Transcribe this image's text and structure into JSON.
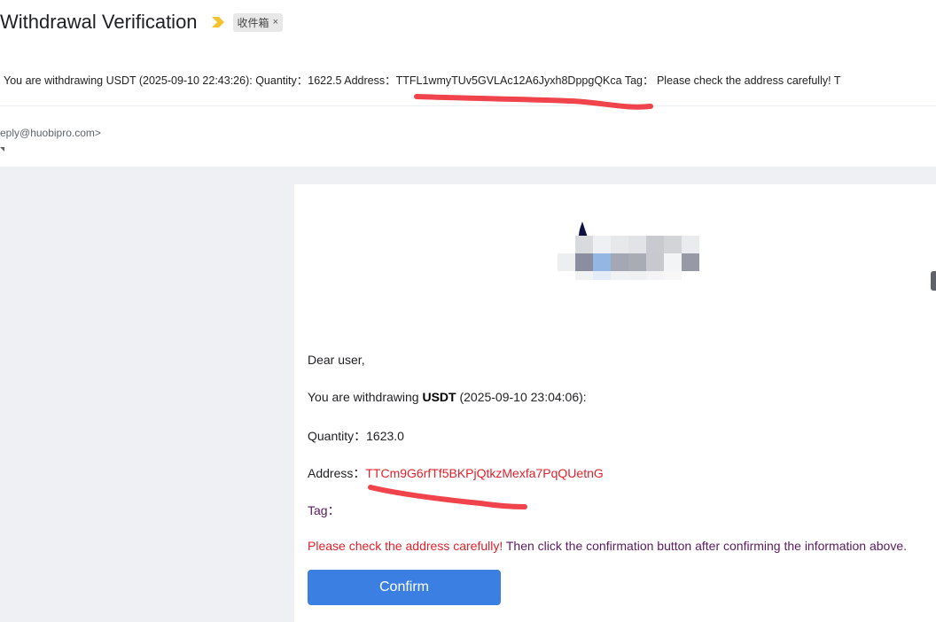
{
  "header": {
    "subject": "Withdrawal Verification",
    "label": "收件箱",
    "label_close": "×",
    "snippet": "You are withdrawing USDT (2025-09-10 22:43:26): Quantity：1622.5 Address：TTFL1wmyTUv5GVLAc12A6Jyxh8DppgQKca Tag：  Please check the address carefully! T",
    "sender": "eply@huobipro.com>"
  },
  "email": {
    "greeting": "Dear user,",
    "withdraw_prefix": "You are withdrawing ",
    "withdraw_coin": "USDT",
    "withdraw_suffix": " (2025-09-10 23:04:06):",
    "quantity_label": "Quantity：",
    "quantity_value": "1623.0",
    "address_label": "Address：",
    "address_value": "TTCm9G6rfTf5BKPjQtkzMexfa7PqQUetnG",
    "tag_label": "Tag：",
    "warning_red": "Please check the address carefully!",
    "warning_rest": " Then click the confirmation button after confirming the information above.",
    "confirm_label": "Confirm"
  },
  "colors": {
    "accent_button": "#3a7fe1",
    "address_red": "#e0212b",
    "annotation_red": "#f0434b",
    "purple_text": "#5b1a61",
    "background": "#eff0f4"
  }
}
